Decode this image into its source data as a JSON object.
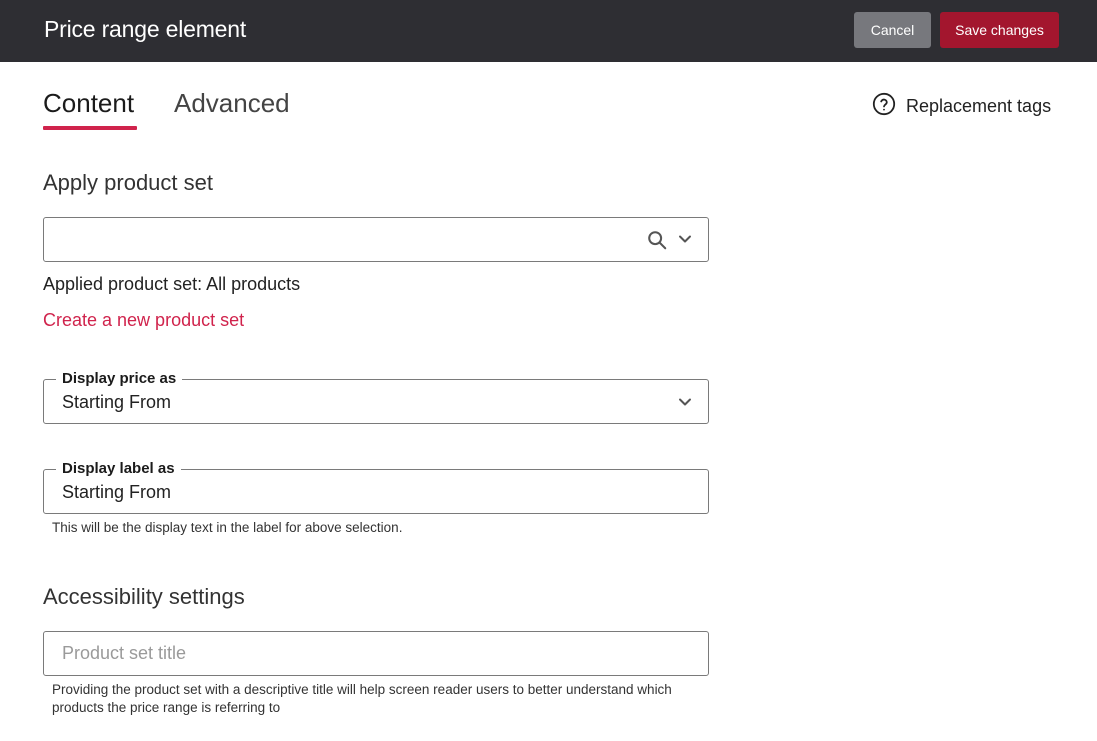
{
  "header": {
    "title": "Price range element",
    "cancel_label": "Cancel",
    "save_label": "Save changes",
    "colors": {
      "bar": "#2e2e33",
      "cancel": "#77787d",
      "save": "#a3162e"
    }
  },
  "tabs": {
    "items": [
      {
        "label": "Content",
        "active": true
      },
      {
        "label": "Advanced",
        "active": false
      }
    ],
    "accent": "#d0234c"
  },
  "replacement_tags": {
    "label": "Replacement tags",
    "icon": "help-circle-icon"
  },
  "apply_product_set": {
    "heading": "Apply product set",
    "search_value": "",
    "applied_text": "Applied product set: All products",
    "create_link": "Create a new product set"
  },
  "display_price": {
    "legend": "Display price as",
    "value": "Starting From"
  },
  "display_label": {
    "legend": "Display label as",
    "value": "Starting From",
    "helper": "This will be the display text in the label for above selection."
  },
  "accessibility": {
    "heading": "Accessibility settings",
    "title_placeholder": "Product set title",
    "helper_line1": "Providing the product set with a descriptive title will help screen reader users to better understand which",
    "helper_line2": "products the price range is referring to"
  }
}
